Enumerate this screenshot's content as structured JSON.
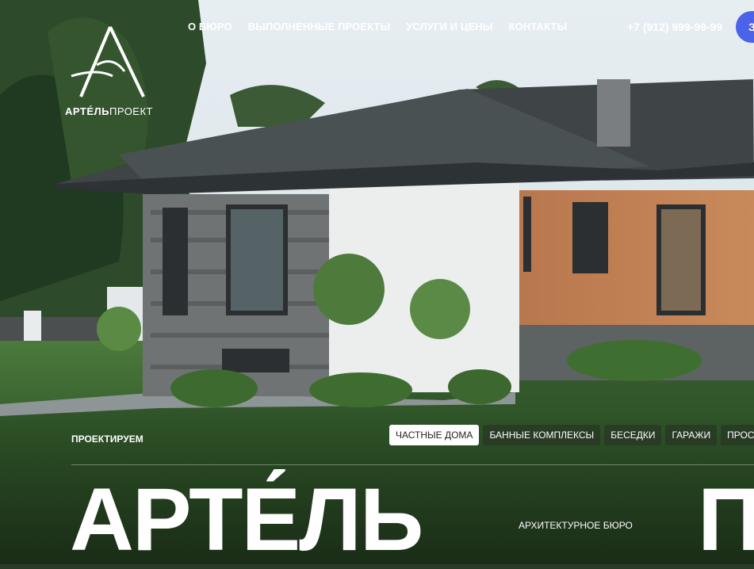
{
  "nav": {
    "items": [
      "О БЮРО",
      "ВЫПОЛНЕННЫЕ ПРОЕКТЫ",
      "УСЛУГИ И ЦЕНЫ",
      "КОНТАКТЫ"
    ]
  },
  "phone": "+7 (912) 999-99-99",
  "cta": {
    "label": "З"
  },
  "logo": {
    "bold": "АРТЕ́ЛЬ",
    "light": "ПРОЕКТ"
  },
  "section": {
    "label": "ПРОЕКТИРУЕМ"
  },
  "categories": [
    {
      "label": "ЧАСТНЫЕ ДОМА",
      "active": true
    },
    {
      "label": "БАННЫЕ КОМПЛЕКСЫ",
      "active": false
    },
    {
      "label": "БЕСЕДКИ",
      "active": false
    },
    {
      "label": "ГАРАЖИ",
      "active": false
    },
    {
      "label": "ПРОСТР",
      "active": false
    }
  ],
  "hero": {
    "title_left": "АРТЕ́ЛЬ",
    "subtitle": "АРХИТЕКТУРНОЕ БЮРО",
    "title_right": "П"
  },
  "colors": {
    "accent": "#4a63e8",
    "grass": "#2f5a2a",
    "sky": "#dfe8ee"
  }
}
